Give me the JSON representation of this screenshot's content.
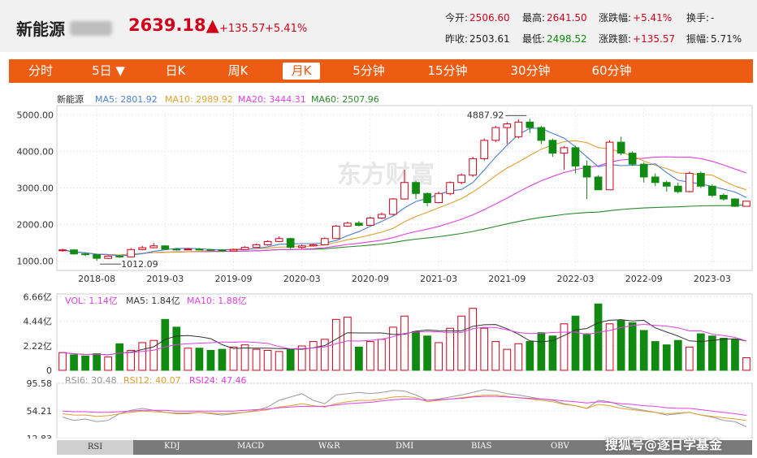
{
  "header": {
    "name": "新能源",
    "price": "2639.18▲",
    "change": "+135.57",
    "change_pct": "+5.41%",
    "stats": [
      {
        "label": "今开:",
        "value": "2506.60",
        "color": "red"
      },
      {
        "label": "最高:",
        "value": "2641.50",
        "color": "red"
      },
      {
        "label": "涨跌幅:",
        "value": "+5.41%",
        "color": "red"
      },
      {
        "label": "换手:",
        "value": "-",
        "color": "black"
      },
      {
        "label": "昨收:",
        "value": "2503.61",
        "color": "black"
      },
      {
        "label": "最低:",
        "value": "2498.52",
        "color": "green"
      },
      {
        "label": "涨跌额:",
        "value": "+135.57",
        "color": "red"
      },
      {
        "label": "振幅:",
        "value": "5.71%",
        "color": "black"
      }
    ]
  },
  "tabs": [
    "分时",
    "5日 ▼",
    "日K",
    "周K",
    "月K",
    "5分钟",
    "15分钟",
    "30分钟",
    "60分钟"
  ],
  "active_tab": "月K",
  "bottom_tabs": [
    "RSI",
    "KDJ",
    "MACD",
    "W&R",
    "DMI",
    "BIAS",
    "OBV",
    ""
  ],
  "source_watermark": "搜狐号@逐日学基金",
  "center_watermark": "东方财富",
  "colors": {
    "accent": "#ec5c12",
    "up": "#d0021b",
    "down": "#118a11",
    "ma5": "#4a7fd6",
    "ma10": "#e0a030",
    "ma20": "#e040e0",
    "ma60": "#2a8a2a"
  },
  "chart_data": [
    {
      "type": "candlestick",
      "legend": {
        "name": "新能源",
        "items": [
          {
            "label": "MA5: 2801.92",
            "color": "#4a7fd6"
          },
          {
            "label": "MA10: 2989.92",
            "color": "#e0a030"
          },
          {
            "label": "MA20: 3444.31",
            "color": "#e040e0"
          },
          {
            "label": "MA60: 2507.96",
            "color": "#2a8a2a"
          }
        ]
      },
      "y_ticks": [
        "5000.00",
        "4000.00",
        "3000.00",
        "2000.00",
        "1000.00"
      ],
      "y_tick_values": [
        5000,
        4000,
        3000,
        2000,
        1000
      ],
      "ylim": [
        750,
        5250
      ],
      "x_ticks": [
        "2018-08",
        "2019-03",
        "2019-09",
        "2020-03",
        "2020-09",
        "2021-03",
        "2021-09",
        "2022-03",
        "2022-09",
        "2023-03"
      ],
      "x_tick_index": [
        3,
        9,
        15,
        21,
        27,
        33,
        39,
        45,
        51,
        57
      ],
      "annotations": [
        {
          "text": "4887.92",
          "index": 41,
          "value": 4887.92
        },
        {
          "text": "1012.09",
          "index": 3,
          "value": 1012.09
        }
      ],
      "candles": [
        [
          1300,
          1310,
          1340,
          1260
        ],
        [
          1310,
          1200,
          1330,
          1180
        ],
        [
          1200,
          1180,
          1230,
          1140
        ],
        [
          1180,
          1080,
          1200,
          1012
        ],
        [
          1080,
          1140,
          1170,
          1060
        ],
        [
          1140,
          1120,
          1180,
          1090
        ],
        [
          1120,
          1320,
          1360,
          1110
        ],
        [
          1320,
          1370,
          1420,
          1300
        ],
        [
          1370,
          1420,
          1500,
          1350
        ],
        [
          1420,
          1330,
          1440,
          1310
        ],
        [
          1330,
          1310,
          1360,
          1290
        ],
        [
          1310,
          1330,
          1350,
          1300
        ],
        [
          1330,
          1320,
          1360,
          1300
        ],
        [
          1320,
          1310,
          1340,
          1290
        ],
        [
          1310,
          1280,
          1330,
          1260
        ],
        [
          1280,
          1320,
          1340,
          1270
        ],
        [
          1320,
          1380,
          1410,
          1310
        ],
        [
          1380,
          1450,
          1480,
          1370
        ],
        [
          1450,
          1540,
          1570,
          1430
        ],
        [
          1540,
          1620,
          1680,
          1520
        ],
        [
          1620,
          1380,
          1640,
          1340
        ],
        [
          1380,
          1420,
          1460,
          1340
        ],
        [
          1420,
          1450,
          1480,
          1400
        ],
        [
          1450,
          1620,
          1650,
          1440
        ],
        [
          1620,
          1960,
          1990,
          1610
        ],
        [
          1960,
          2040,
          2080,
          1940
        ],
        [
          2040,
          1980,
          2100,
          1950
        ],
        [
          1980,
          2180,
          2220,
          1970
        ],
        [
          2180,
          2280,
          2330,
          2150
        ],
        [
          2280,
          2700,
          2720,
          2250
        ],
        [
          2700,
          3150,
          3500,
          2680
        ],
        [
          3150,
          2850,
          3200,
          2700
        ],
        [
          2850,
          2600,
          2880,
          2500
        ],
        [
          2600,
          2850,
          2900,
          2580
        ],
        [
          2850,
          3150,
          3180,
          2800
        ],
        [
          3150,
          3350,
          3400,
          3100
        ],
        [
          3350,
          3800,
          3850,
          3300
        ],
        [
          3800,
          4300,
          4350,
          3750
        ],
        [
          4300,
          4650,
          4700,
          4250
        ],
        [
          4650,
          4750,
          4800,
          4200
        ],
        [
          4400,
          4800,
          4870,
          4350
        ],
        [
          4800,
          4650,
          4887.92,
          4500
        ],
        [
          4650,
          4300,
          4700,
          4200
        ],
        [
          4300,
          3950,
          4350,
          3850
        ],
        [
          3950,
          4100,
          4150,
          3500
        ],
        [
          4100,
          3600,
          4150,
          3400
        ],
        [
          3600,
          3300,
          3750,
          2700
        ],
        [
          3300,
          2950,
          3350,
          2950
        ],
        [
          2950,
          4250,
          4300,
          2950
        ],
        [
          4250,
          3950,
          4400,
          3900
        ],
        [
          3950,
          3650,
          4000,
          3600
        ],
        [
          3650,
          3300,
          3700,
          3150
        ],
        [
          3300,
          3150,
          3400,
          3050
        ],
        [
          3150,
          3050,
          3200,
          2900
        ],
        [
          3050,
          2900,
          3150,
          2850
        ],
        [
          2900,
          3400,
          3450,
          2880
        ],
        [
          3400,
          3050,
          3450,
          3000
        ],
        [
          3050,
          2800,
          3100,
          2750
        ],
        [
          2800,
          2700,
          2850,
          2650
        ],
        [
          2700,
          2500,
          2720,
          2480
        ],
        [
          2500,
          2639.18,
          2641.5,
          2498.52
        ]
      ]
    },
    {
      "type": "bar",
      "legend": {
        "items": [
          {
            "label": "VOL: 1.14亿",
            "color": "#e040e0"
          },
          {
            "label": "MA5: 1.84亿",
            "color": "#333333"
          },
          {
            "label": "MA10: 1.88亿",
            "color": "#e040e0"
          }
        ]
      },
      "y_ticks": [
        "6.66亿",
        "4.44亿",
        "2.22亿",
        "0"
      ],
      "y_tick_values": [
        6.66,
        4.44,
        2.22,
        0
      ],
      "ylim": [
        0,
        6.9
      ],
      "unit": "亿",
      "values": [
        1.6,
        1.4,
        1.3,
        1.5,
        1.2,
        2.4,
        1.8,
        2.5,
        2.7,
        4.6,
        3.9,
        2.0,
        2.0,
        1.8,
        1.9,
        2.1,
        2.3,
        1.9,
        1.8,
        1.7,
        1.9,
        2.2,
        2.6,
        2.8,
        4.6,
        4.8,
        2.1,
        2.6,
        2.8,
        3.9,
        4.9,
        3.5,
        3.1,
        2.5,
        3.8,
        4.9,
        5.6,
        3.8,
        2.6,
        1.9,
        2.4,
        2.6,
        3.4,
        3.1,
        4.2,
        4.9,
        3.3,
        6.0,
        4.2,
        4.5,
        4.3,
        3.6,
        2.6,
        2.3,
        2.7,
        2.1,
        3.3,
        3.1,
        2.9,
        2.8,
        1.14
      ]
    },
    {
      "type": "line",
      "legend": {
        "items": [
          {
            "label": "RSI6: 30.48",
            "color": "#999999"
          },
          {
            "label": "RSI12: 40.07",
            "color": "#e0a030"
          },
          {
            "label": "RSI24: 47.46",
            "color": "#e040e0"
          }
        ]
      },
      "y_ticks": [
        "95.58",
        "54.21",
        "12.83"
      ],
      "y_tick_values": [
        95.58,
        54.21,
        12.83
      ],
      "ylim": [
        12.83,
        95.58
      ],
      "series": [
        {
          "name": "RSI6",
          "color": "#999999",
          "values": [
            45,
            40,
            42,
            38,
            40,
            50,
            55,
            58,
            55,
            52,
            50,
            50,
            52,
            50,
            48,
            50,
            52,
            55,
            60,
            70,
            75,
            80,
            70,
            65,
            78,
            80,
            82,
            80,
            82,
            85,
            84,
            78,
            70,
            72,
            75,
            78,
            82,
            86,
            84,
            80,
            78,
            75,
            72,
            70,
            65,
            62,
            58,
            70,
            68,
            62,
            58,
            55,
            52,
            48,
            50,
            52,
            48,
            45,
            40,
            38,
            30.48
          ]
        },
        {
          "name": "RSI12",
          "color": "#e0a030",
          "values": [
            50,
            48,
            48,
            46,
            47,
            50,
            52,
            54,
            53,
            52,
            51,
            51,
            52,
            51,
            50,
            51,
            52,
            54,
            56,
            60,
            62,
            65,
            62,
            60,
            65,
            68,
            70,
            70,
            72,
            75,
            76,
            74,
            68,
            70,
            72,
            74,
            76,
            78,
            78,
            76,
            74,
            72,
            70,
            68,
            64,
            62,
            58,
            64,
            62,
            58,
            56,
            54,
            52,
            50,
            51,
            52,
            48,
            46,
            44,
            42,
            40.07
          ]
        },
        {
          "name": "RSI24",
          "color": "#e040e0",
          "values": [
            54,
            53,
            53,
            52,
            52,
            53,
            54,
            55,
            55,
            55,
            54,
            54,
            54,
            54,
            54,
            54,
            55,
            56,
            57,
            59,
            60,
            61,
            61,
            61,
            63,
            65,
            66,
            67,
            69,
            71,
            72,
            72,
            70,
            71,
            72,
            73,
            75,
            76,
            76,
            75,
            74,
            73,
            72,
            71,
            69,
            68,
            66,
            68,
            67,
            65,
            64,
            62,
            61,
            59,
            58,
            58,
            56,
            54,
            52,
            50,
            47.46
          ]
        }
      ]
    }
  ]
}
